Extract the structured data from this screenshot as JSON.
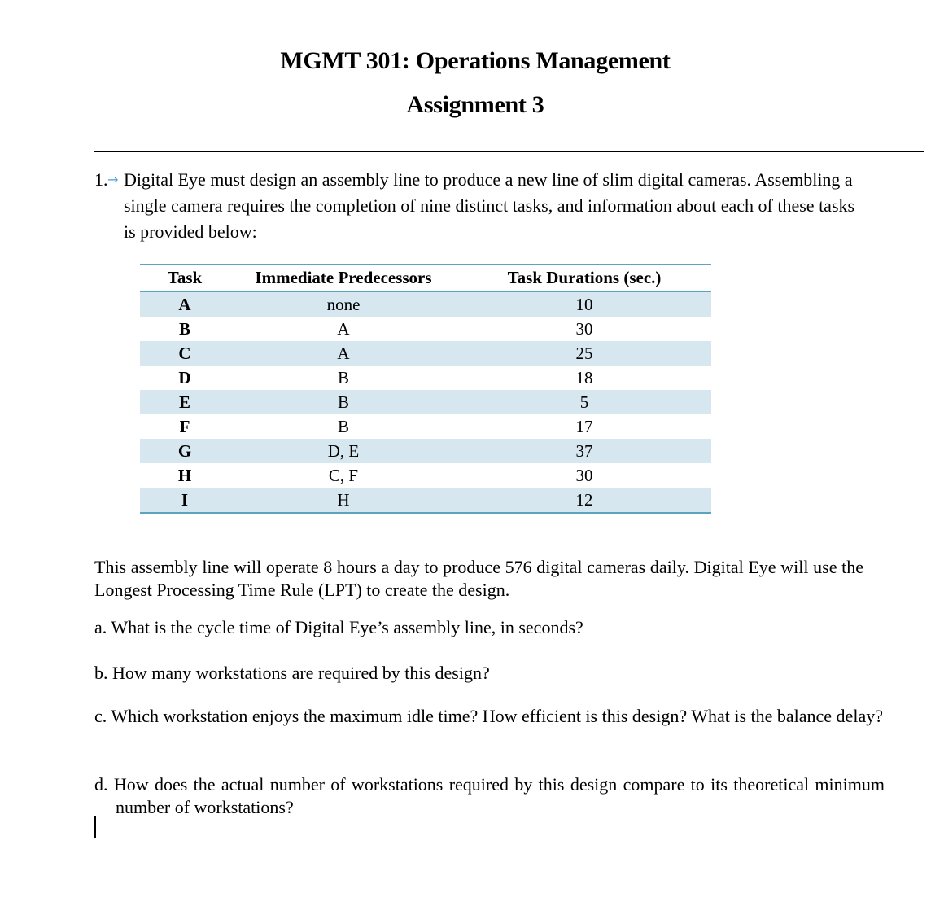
{
  "document": {
    "title": "MGMT 301: Operations Management",
    "subtitle": "Assignment 3",
    "question1": {
      "number": "1.",
      "tab_marker_icon": "tab-arrow-icon",
      "intro": "Digital Eye must design an assembly line to produce a new line of slim digital cameras. Assembling a single camera requires the completion of nine distinct tasks, and information about each of these tasks is provided below:"
    },
    "table": {
      "headers": [
        "Task",
        "Immediate Predecessors",
        "Task Durations (sec.)"
      ],
      "rows": [
        {
          "task": "A",
          "predecessors": "none",
          "duration": "10"
        },
        {
          "task": "B",
          "predecessors": "A",
          "duration": "30"
        },
        {
          "task": "C",
          "predecessors": "A",
          "duration": "25"
        },
        {
          "task": "D",
          "predecessors": "B",
          "duration": "18"
        },
        {
          "task": "E",
          "predecessors": "B",
          "duration": "5"
        },
        {
          "task": "F",
          "predecessors": "B",
          "duration": "17"
        },
        {
          "task": "G",
          "predecessors": "D, E",
          "duration": "37"
        },
        {
          "task": "H",
          "predecessors": "C, F",
          "duration": "30"
        },
        {
          "task": "I",
          "predecessors": "H",
          "duration": "12"
        }
      ],
      "border_color": "#5ba3c0",
      "stripe_color": "#d7e7ef"
    },
    "context": "This assembly line will operate 8 hours a day to produce 576 digital cameras daily. Digital Eye will use the Longest Processing Time Rule (LPT) to create the design.",
    "questions": {
      "a": "a. What is the cycle time of Digital Eye’s assembly line, in seconds?",
      "b": "b. How many workstations are required by this design?",
      "c": "c. Which workstation enjoys the maximum idle time? How efficient is this design? What is the balance delay?",
      "d": "d. How does the actual number of workstations required by this design compare to its theoretical minimum number of workstations?"
    }
  }
}
